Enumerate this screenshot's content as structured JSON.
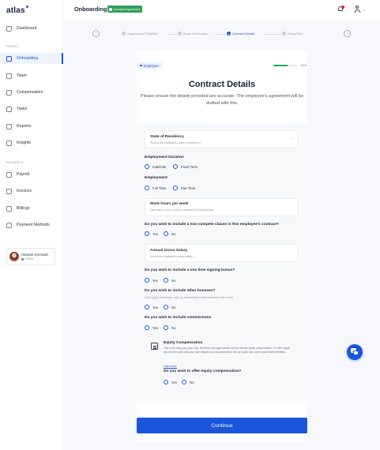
{
  "brand": {
    "logo": "atlas",
    "accent": "#1a56db",
    "success": "#2e9e5b"
  },
  "sidebar": {
    "items": [
      {
        "label": "Dashboard",
        "icon": "grid-icon"
      },
      {
        "label": "Onboarding",
        "icon": "user-icon",
        "active": true
      },
      {
        "label": "Team",
        "icon": "team-icon"
      },
      {
        "label": "Compensation",
        "icon": "money-icon"
      },
      {
        "label": "Tasks",
        "icon": "clipboard-icon"
      },
      {
        "label": "Reports",
        "icon": "chart-icon"
      },
      {
        "label": "Insights",
        "icon": "insights-icon"
      },
      {
        "label": "Payroll",
        "icon": "wallet-icon"
      },
      {
        "label": "Invoices",
        "icon": "invoice-icon"
      },
      {
        "label": "Billings",
        "icon": "billing-icon"
      },
      {
        "label": "Payment Methods",
        "icon": "card-icon"
      }
    ],
    "section_people": "PEOPLE",
    "section_payments": "PAYMENTS",
    "user": {
      "name": "Hannah Jeremiah",
      "status": "Online"
    }
  },
  "header": {
    "title": "Onboarding",
    "badge": "Accepted Agreement"
  },
  "stepper": {
    "steps": [
      {
        "num": "1",
        "label": "Employment Eligibility"
      },
      {
        "num": "2",
        "label": "Basic Information"
      },
      {
        "num": "3",
        "label": "Contract Details",
        "active": true
      },
      {
        "num": "4",
        "label": "Hiring Plan"
      }
    ]
  },
  "main": {
    "chip": "Employee",
    "progress_fraction": 0.6,
    "progress_text": "60%",
    "title": "Contract Details",
    "subtitle": "Please ensure the details provided are accurate. The employee's agreement will be drafted with this.",
    "state": {
      "label": "State of Residency",
      "placeholder": "What is the employee's state of residence?"
    },
    "duration": {
      "label": "Employment Duration",
      "options": [
        "Indefinite",
        "Fixed Term"
      ]
    },
    "employment": {
      "label": "Employment",
      "options": [
        "Full Time",
        "Part Time"
      ]
    },
    "hours": {
      "label": "Work hours per week",
      "placeholder": "How many hours of work is expected of this employee"
    },
    "noncompete": {
      "question": "Do you wish to include a non-compete clause in this employee's contract?",
      "options": [
        "Yes",
        "No"
      ]
    },
    "salary": {
      "label": "Annual Gross Salary",
      "placeholder": "What's the employee's yearly salary"
    },
    "signing": {
      "question": "Do you wish to include a one time signing bonus?",
      "options": [
        "Yes",
        "No"
      ]
    },
    "other_bonuses": {
      "question": "Do you wish to include other bonuses?",
      "sub": "Other types of bonuses, such as performance related bonuses Learn more",
      "options": [
        "Yes",
        "No"
      ]
    },
    "commissions": {
      "question": "Do you wish to include commissions",
      "options": [
        "Yes",
        "No"
      ]
    },
    "equity": {
      "title": "Equity Compensation",
      "desc": "This is the thing you pass only. Describe how agreements will not include equity compensation. To offer equity, you need to work with your own lawyers and accountants to set up a plan that covers your team members.",
      "link": "Learn more",
      "question": "Do you wish to offer equity compensation?",
      "options": [
        "Yes",
        "No"
      ]
    },
    "continue_label": "Continue"
  }
}
